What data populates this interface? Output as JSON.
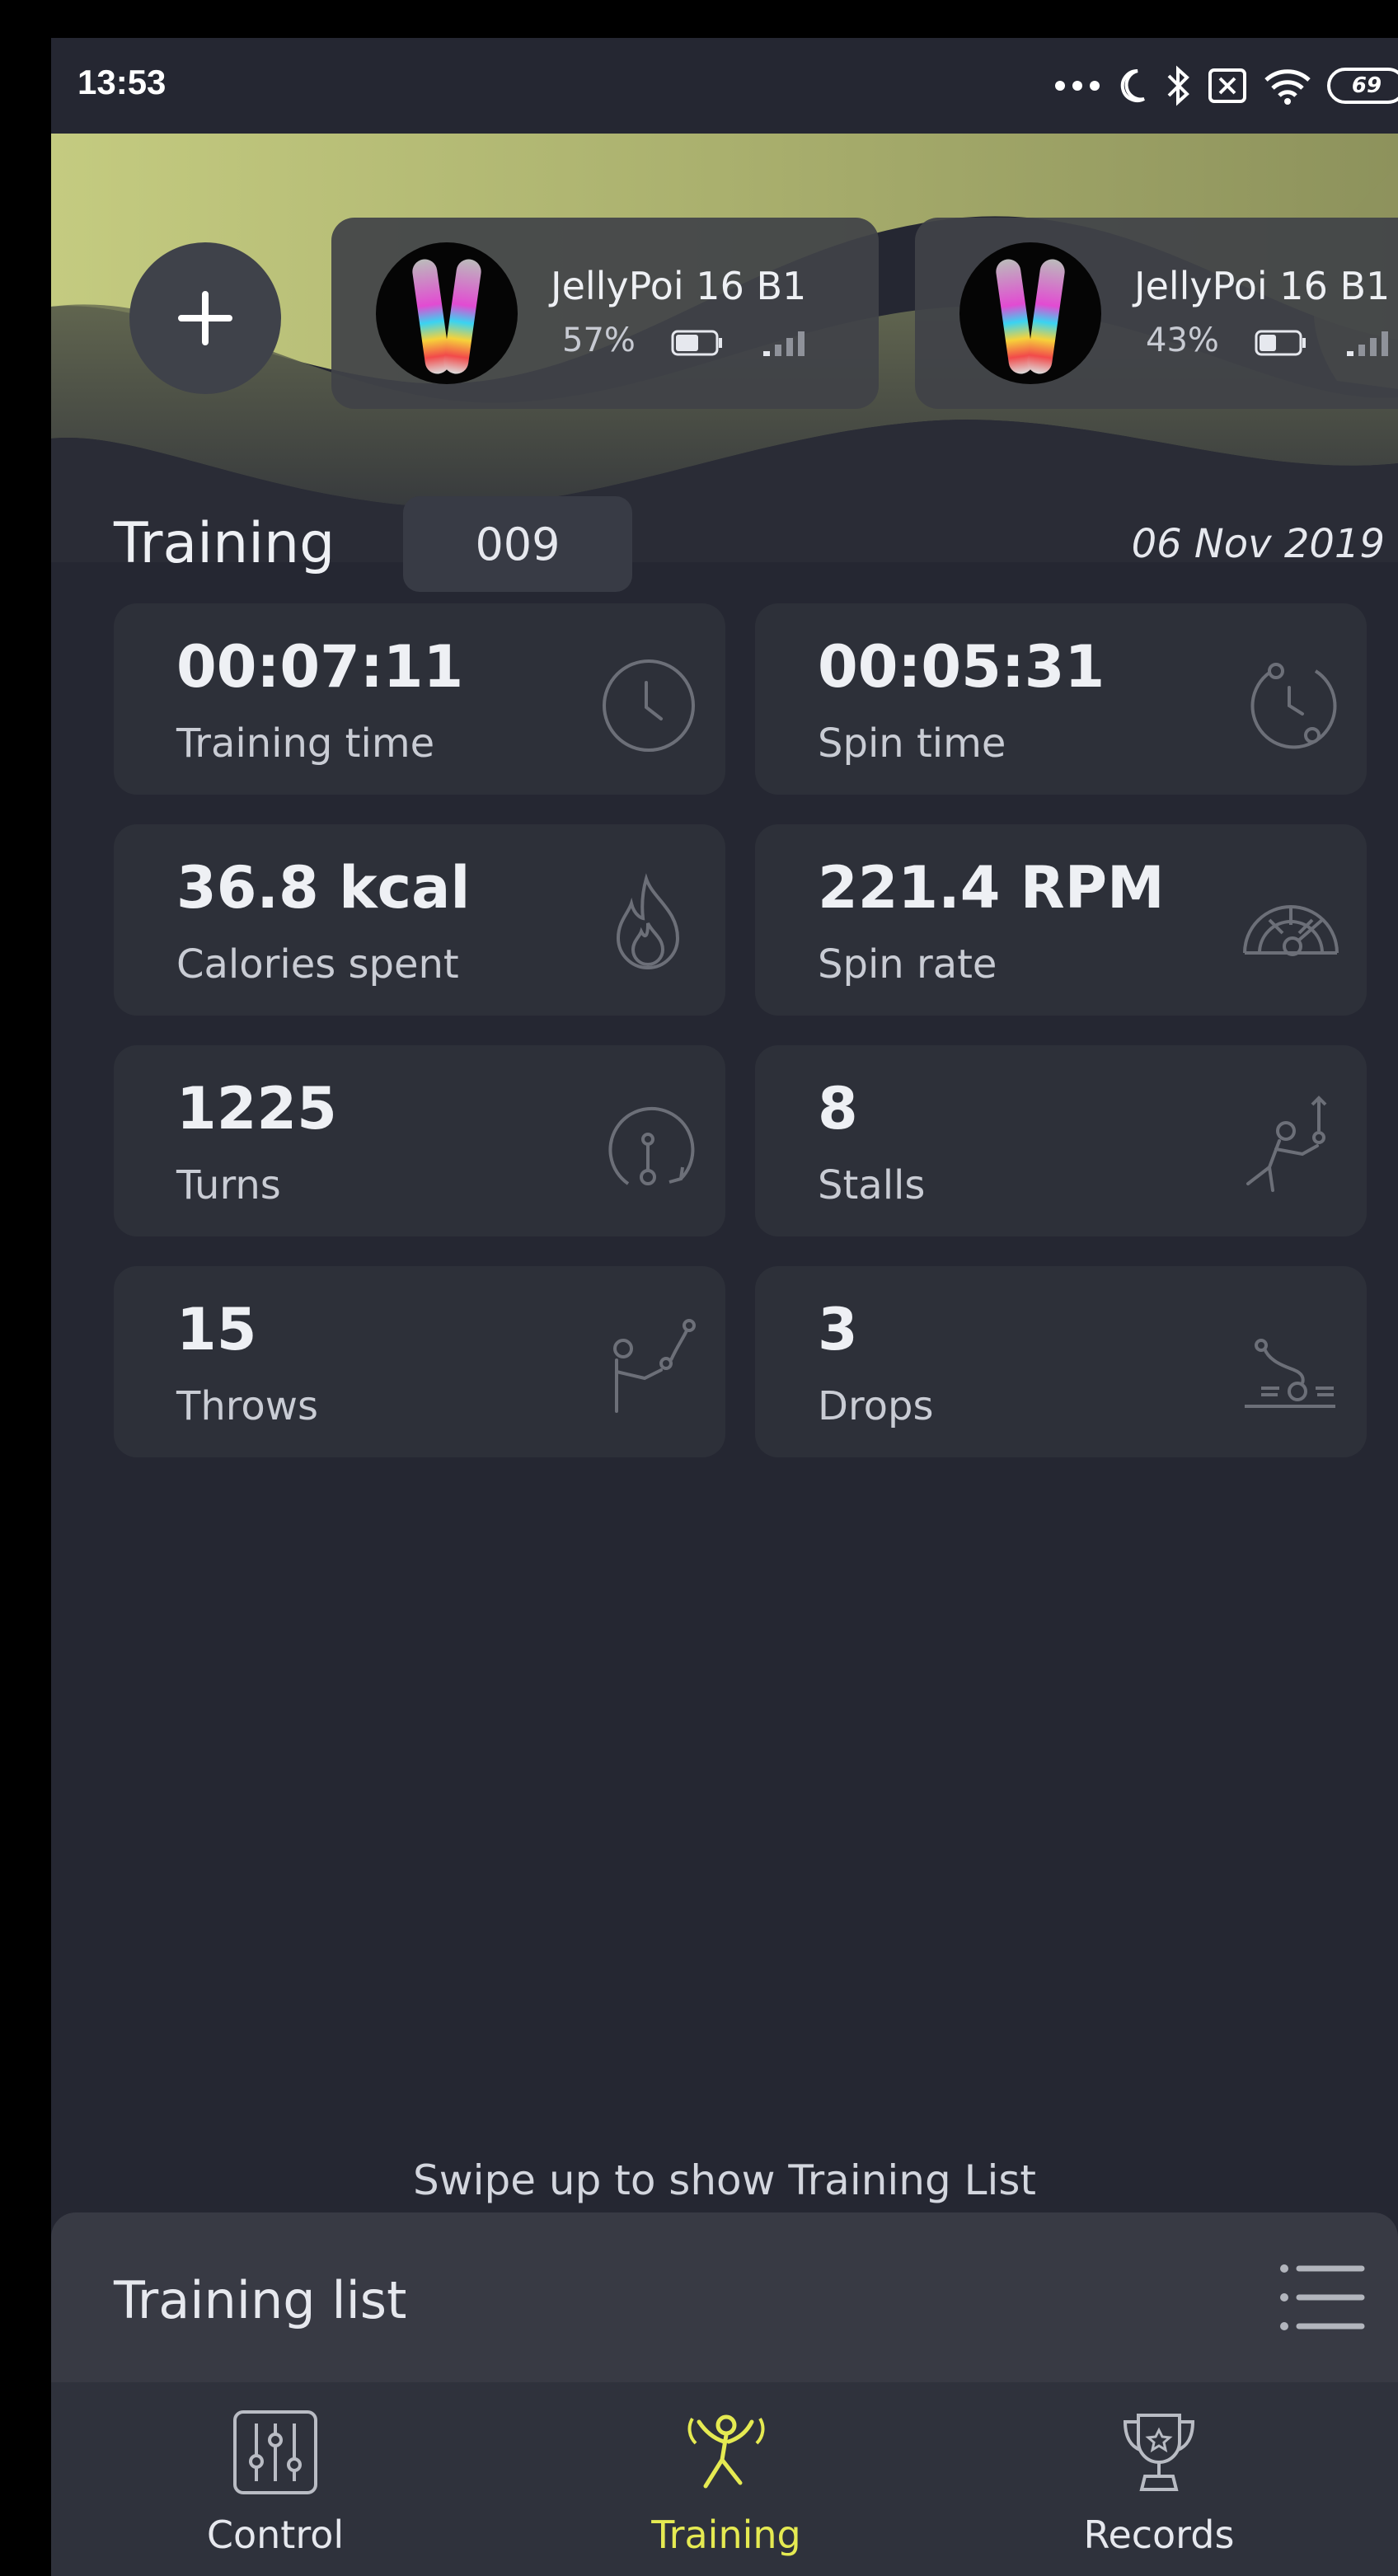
{
  "status_bar": {
    "time": "13:53",
    "battery": "69",
    "icons": [
      "more-icon",
      "moon-icon",
      "bluetooth-icon",
      "sim-off-icon",
      "wifi-icon",
      "battery-icon"
    ]
  },
  "devices": [
    {
      "name": "JellyPoi 16 B1",
      "battery": "57%",
      "battery_level": 0.57
    },
    {
      "name": "JellyPoi 16 B1",
      "battery": "43%",
      "battery_level": 0.43
    }
  ],
  "add_device_icon": "plus-icon",
  "training": {
    "title": "Training",
    "number": "009",
    "date": "06 Nov 2019"
  },
  "stats": [
    {
      "value": "00:07:11",
      "label": "Training time",
      "icon": "clock-icon"
    },
    {
      "value": "00:05:31",
      "label": "Spin time",
      "icon": "spin-time-icon"
    },
    {
      "value": "36.8 kcal",
      "label": "Calories spent",
      "icon": "flame-icon"
    },
    {
      "value": "221.4 RPM",
      "label": "Spin rate",
      "icon": "speedometer-icon"
    },
    {
      "value": "1225",
      "label": "Turns",
      "icon": "turns-icon"
    },
    {
      "value": "8",
      "label": "Stalls",
      "icon": "stall-icon"
    },
    {
      "value": "15",
      "label": "Throws",
      "icon": "throw-icon"
    },
    {
      "value": "3",
      "label": "Drops",
      "icon": "drop-icon"
    }
  ],
  "swipe_hint": "Swipe up to show Training List",
  "training_list": {
    "title": "Training list",
    "icon": "list-icon"
  },
  "nav": [
    {
      "label": "Control",
      "icon": "sliders-icon",
      "active": false
    },
    {
      "label": "Training",
      "icon": "dancer-icon",
      "active": true
    },
    {
      "label": "Records",
      "icon": "trophy-icon",
      "active": false
    }
  ],
  "colors": {
    "background": "#252732",
    "card": "#2d3039",
    "accent": "#e5ea52",
    "header_wave": "#c9cf86"
  }
}
